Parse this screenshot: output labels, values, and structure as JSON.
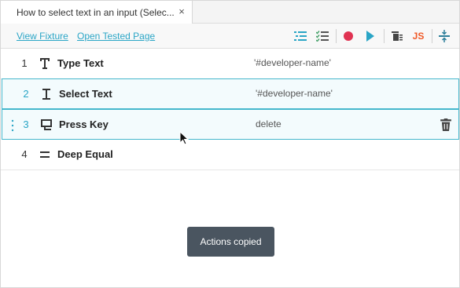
{
  "tab": {
    "title": "How to select text in an input (Selec...",
    "close_glyph": "×"
  },
  "toolbar": {
    "view_fixture": "View Fixture",
    "open_tested_page": "Open Tested Page",
    "js_label": "JS",
    "icons": [
      "indent-list-icon",
      "checklist-icon",
      "record-icon",
      "run-icon",
      "delete-all-icon",
      "export-js-icon",
      "collapse-icon"
    ],
    "colors": {
      "record": "#e03352",
      "run": "#2aa5c6",
      "js": "#f05a28",
      "link": "#2aa5c6",
      "accent_green": "#4aa36d"
    }
  },
  "commands": [
    {
      "number": "1",
      "name": "Type Text",
      "param": "'#developer-name'",
      "icon": "type-text-icon"
    },
    {
      "number": "2",
      "name": "Select Text",
      "param": "'#developer-name'",
      "icon": "text-cursor-icon"
    },
    {
      "number": "3",
      "name": "Press Key",
      "param": "delete",
      "icon": "keyboard-key-icon"
    },
    {
      "number": "4",
      "name": "Deep Equal",
      "param": "",
      "icon": "equals-icon"
    }
  ],
  "toast": {
    "message": "Actions copied"
  }
}
